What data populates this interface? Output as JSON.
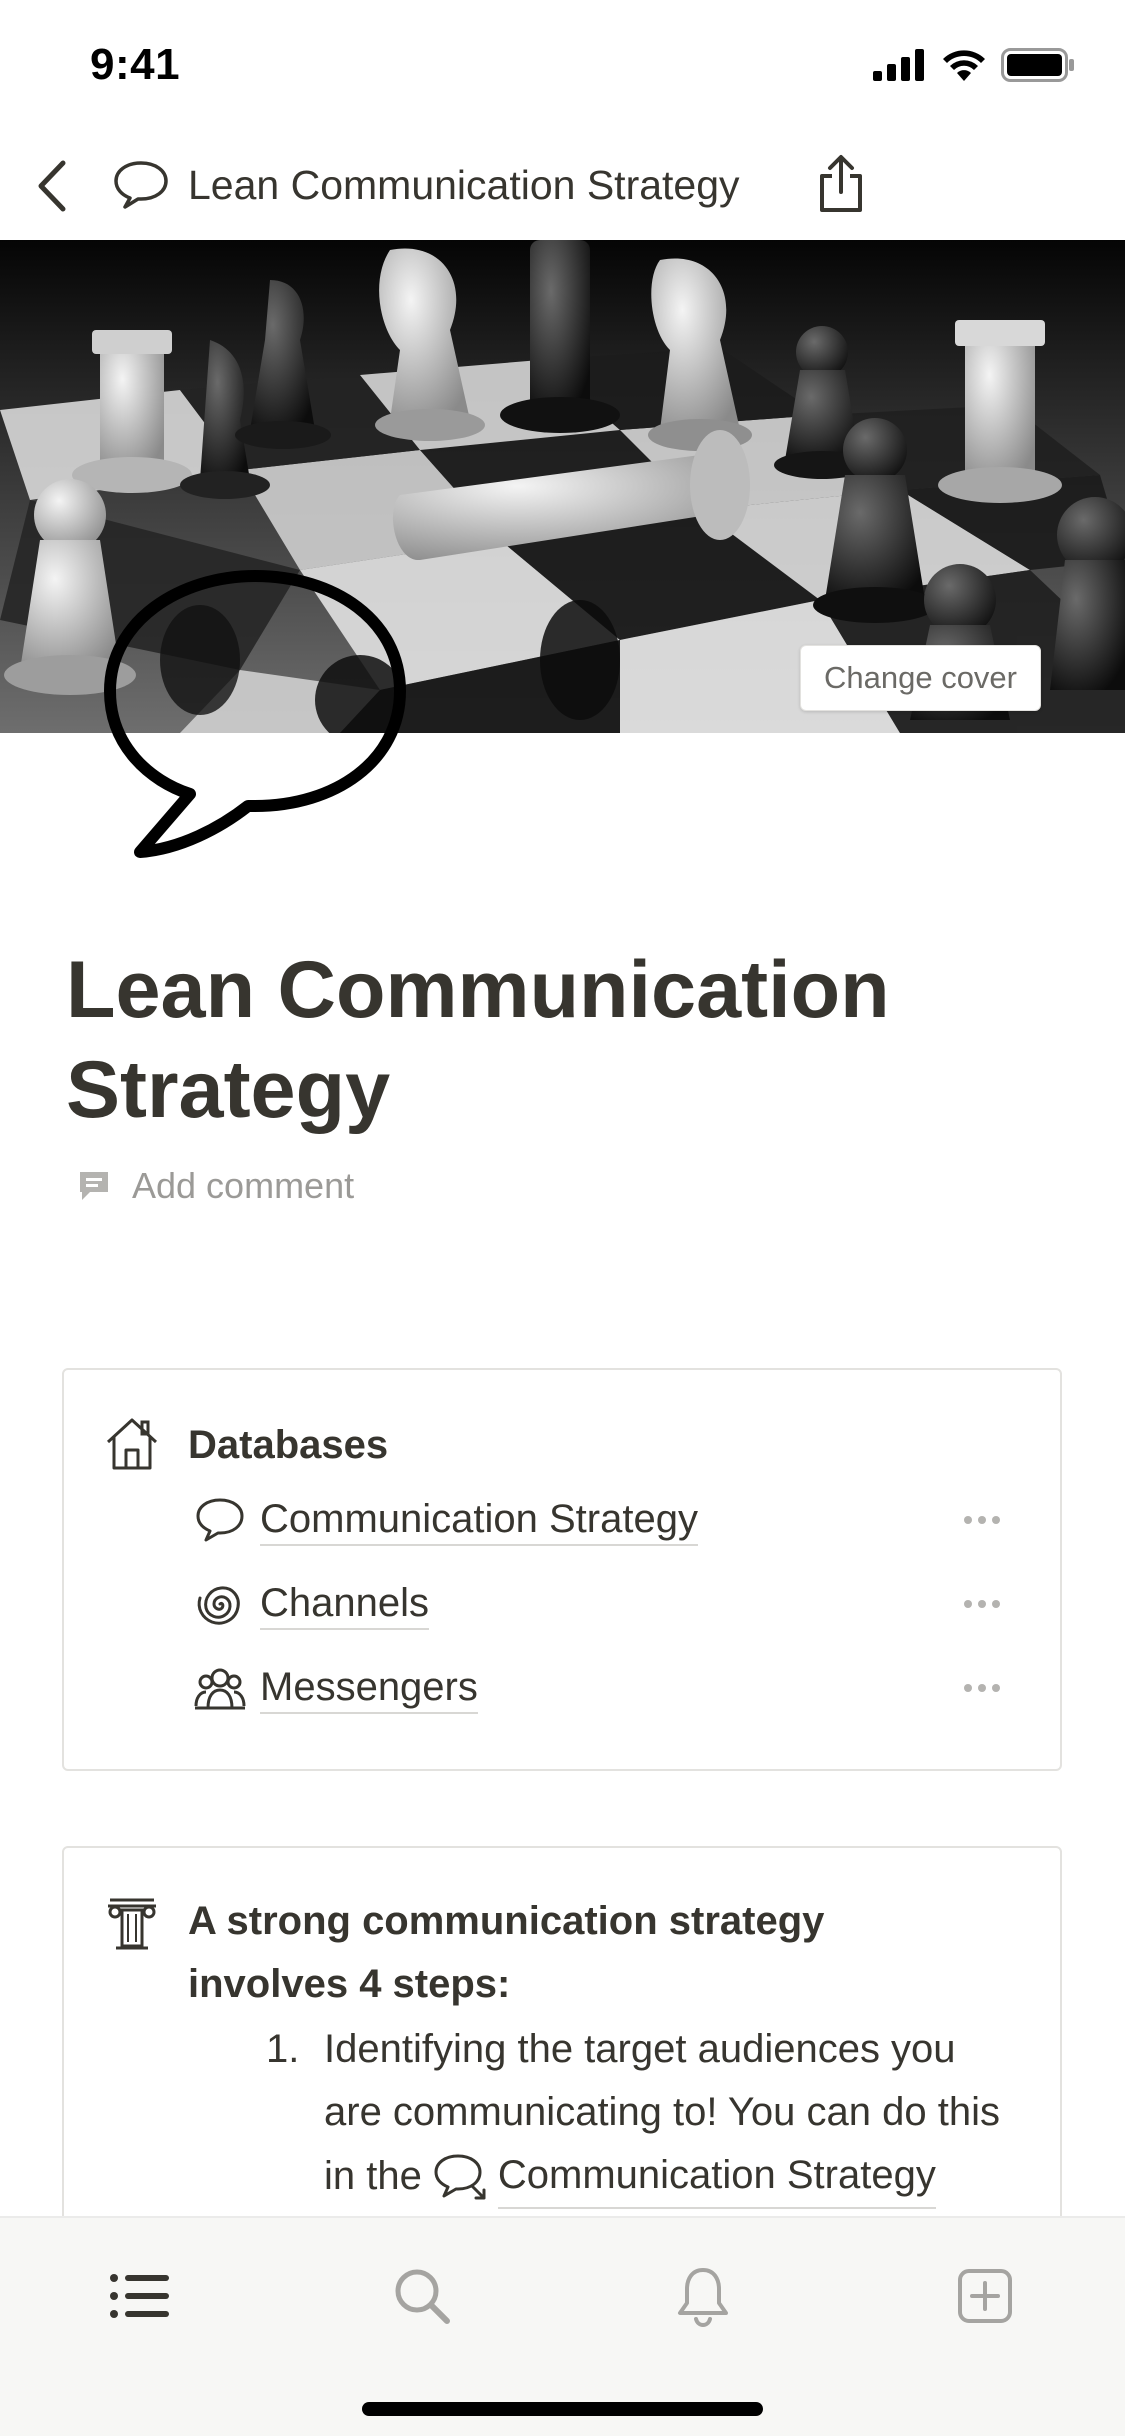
{
  "status_bar": {
    "time": "9:41"
  },
  "nav": {
    "title": "Lean Communication Strategy",
    "icons": {
      "back": "chevron-left-icon",
      "page": "speech-bubble-icon",
      "share": "share-icon"
    }
  },
  "cover": {
    "change_cover_label": "Change cover"
  },
  "page": {
    "title": "Lean Communication Strategy",
    "add_comment_label": "Add comment"
  },
  "databases_callout": {
    "icon": "house-icon",
    "heading": "Databases",
    "items": [
      {
        "label": "Communication Strategy",
        "icon": "speech-bubble-icon"
      },
      {
        "label": "Channels",
        "icon": "spiral-icon"
      },
      {
        "label": "Messengers",
        "icon": "people-icon"
      }
    ]
  },
  "steps_callout": {
    "icon": "pillar-icon",
    "heading_line1": "A strong communication strategy",
    "heading_line2": "involves 4 steps:",
    "items": [
      {
        "number": "1.",
        "line1": "Identifying the target audiences you",
        "line2": "are communicating to! You can do this",
        "line3_prefix": "in the",
        "link": "Communication Strategy"
      }
    ]
  },
  "tab_bar": {
    "tabs": [
      "list-icon",
      "search-icon",
      "bell-icon",
      "new-page-icon"
    ]
  },
  "colors": {
    "text": "#37352f",
    "muted": "#9b9a97",
    "border": "#e3e2df"
  }
}
